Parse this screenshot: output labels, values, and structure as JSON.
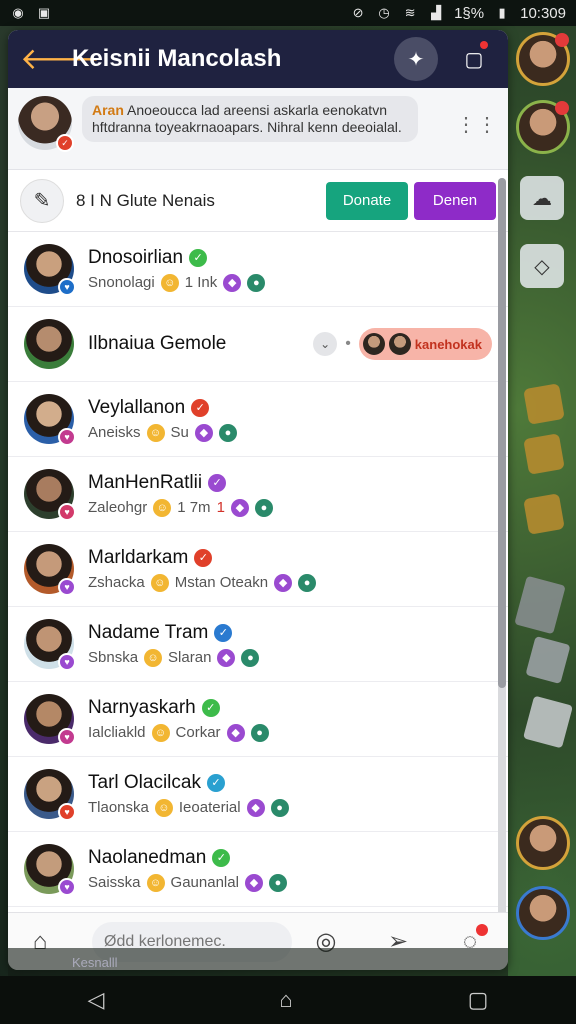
{
  "status": {
    "time": "10:309",
    "battery": "1§%"
  },
  "header": {
    "title": "Keisnii Mancolash"
  },
  "notice": {
    "name": "Aran",
    "body": "Anoeoucca lad areensi askarla eenokatvn hftdranna toyeakrnaoapars. Nihral kenn deeoialal."
  },
  "toolbar": {
    "group_label": "8  I N Glute Nenais",
    "btn_primary": "Donate",
    "btn_secondary": "Denen"
  },
  "members": [
    {
      "name": "Dnosoirlian",
      "sub_a": "Snonolagi",
      "sub_b": "1  Ink",
      "verify": "#3dbb4a",
      "badge": "#1e6ec8"
    },
    {
      "name": "Ilbnaiua Gemole",
      "sub_a": "",
      "sub_b": "",
      "pill": "kanehokak",
      "verify": "",
      "badge": ""
    },
    {
      "name": "Veylallanon",
      "sub_a": "Aneisks",
      "sub_b": "Su",
      "verify": "#e0402a",
      "badge": "#c23a8f"
    },
    {
      "name": "ManHenRatlii",
      "sub_a": "Zaleohgr",
      "sub_b": "1    7m",
      "sub_c": "1",
      "verify": "#9a4ad0",
      "badge": "#d23a6a"
    },
    {
      "name": "Marldarkam",
      "sub_a": "Zshacka",
      "sub_b": "Mstan Oteakn",
      "verify": "#e0402a",
      "badge": "#9a4ad0"
    },
    {
      "name": "Nadame Tram",
      "sub_a": "Sbnska",
      "sub_b": "Slaran",
      "verify": "#2a7ad0",
      "badge": "#9a4ad0"
    },
    {
      "name": "Narnyaskarh",
      "sub_a": "Ialcliakld",
      "sub_b": "Corkar",
      "verify": "#3dbb4a",
      "badge": "#c23a8f"
    },
    {
      "name": "Tarl Olacilcak",
      "sub_a": "Tlaonska",
      "sub_b": "Ieoaterial",
      "verify": "#2aa0d0",
      "badge": "#e0402a"
    },
    {
      "name": "Naolanedman",
      "sub_a": "Saisska",
      "sub_b": "Gaunanlal",
      "verify": "#3dbb4a",
      "badge": "#9a4ad0"
    }
  ],
  "composer": {
    "placeholder": "Ødd kerlonemec."
  },
  "bottom_strip": {
    "label": "Kesnalll"
  }
}
